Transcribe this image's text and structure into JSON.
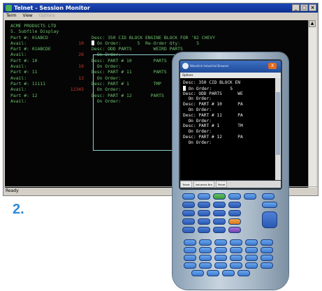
{
  "window": {
    "title": "Telnet - Session Monitor",
    "menu": [
      "Term",
      "View",
      "Options"
    ],
    "status": "Ready",
    "buttons": {
      "minimize": "_",
      "maximize": "□",
      "close": "×"
    }
  },
  "terminal": {
    "lines": [
      {
        "a": "ACME PRODUCTS LTD",
        "ac": "g"
      },
      {
        "a": "5. Subfile Display",
        "ac": "g"
      },
      {
        "a": "Part #: 01ABCD",
        "ac": "g",
        "b": "Desc: 350 CID BLOCK ENGINE BLOCK FOR '82 CHEVY",
        "bc": "g"
      },
      {
        "a": "Avail:",
        "ac": "g",
        "v": "10",
        "b": "On Order:      5  Re-Order Qty:      5",
        "bc": "g",
        "cursor": true
      },
      {
        "a": "Part #: 01ABCDE",
        "ac": "g",
        "b": "Desc: ODD PARTS        WEIRD PARTS",
        "bc": "g"
      },
      {
        "a": "Avail:",
        "ac": "g",
        "v": "26",
        "b": "  On Order:",
        "bc": "g"
      },
      {
        "a": "Part #: 10",
        "ac": "g",
        "b": "Desc: PART # 10        PARTS",
        "bc": "g"
      },
      {
        "a": "Avail:",
        "ac": "g",
        "v": "10",
        "b": "  On Order:",
        "bc": "g"
      },
      {
        "a": "Part #: 11",
        "ac": "g",
        "b": "Desc: PART # 11        PARTS",
        "bc": "g"
      },
      {
        "a": "Avail:",
        "ac": "g",
        "v": "13",
        "b": "  On Order:",
        "bc": "g"
      },
      {
        "a": "Part #: 11111",
        "ac": "g",
        "b": "Desc: PART # 1         TMP",
        "bc": "g"
      },
      {
        "a": "Avail:",
        "ac": "g",
        "v": "12345",
        "b": "  On Order:",
        "bc": "g"
      },
      {
        "a": "Part #: 12",
        "ac": "g",
        "b": "Desc: PART # 12       PARTS",
        "bc": "g"
      },
      {
        "a": "Avail:",
        "ac": "g",
        "v": "",
        "b": "  On Order:",
        "bc": "g"
      }
    ]
  },
  "step_label": "2.",
  "device": {
    "app_title": "Wavelink Industrial Browser",
    "close_label": "X",
    "menu": [
      "Options"
    ],
    "lines": [
      "Desc: 350 CID BLOCK EN",
      "  On Order:       5",
      "Desc: ODD PARTS      WE",
      "  On Order:",
      "Desc: PART # 10      PA",
      "  On Order:",
      "Desc: PART # 11      PA",
      "  On Order:",
      "Desc: PART # 1       TM",
      "  On Order:",
      "Desc: PART # 12      PA",
      "  On Order:"
    ],
    "taskbar": [
      "Telnet",
      "Industrial Bro",
      "Telnet"
    ],
    "colors": {
      "key_blue": "#2a59b3",
      "key_green": "#3a9a3b",
      "key_orange": "#d9781a",
      "key_purple": "#7442ad"
    }
  }
}
